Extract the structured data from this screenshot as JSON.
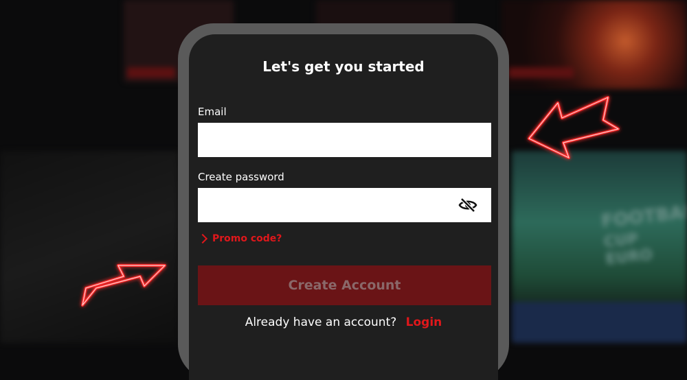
{
  "form": {
    "title": "Let's get you started",
    "email_label": "Email",
    "email_value": "",
    "password_label": "Create password",
    "password_value": "",
    "promo_label": "Promo code?",
    "create_button": "Create Account",
    "already_text": "Already have an account?",
    "login_link": "Login"
  },
  "icons": {
    "password_toggle": "eye-slash-icon",
    "promo_expander": "chevron-right-icon",
    "decor_left": "neon-arrow-right-icon",
    "decor_right": "neon-arrow-left-icon"
  },
  "background": {
    "promo_tile_line_1": "FOOTBALL",
    "promo_tile_line_2": "CUP EURO"
  },
  "colors": {
    "accent": "#e0171b",
    "button_bg": "#6a1416",
    "frame": "#5a5a5a",
    "screen": "#1f1f1f"
  }
}
